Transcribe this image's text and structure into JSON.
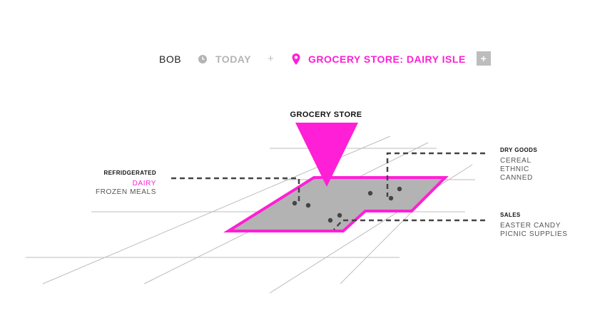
{
  "header": {
    "user": "BOB",
    "time_icon": "clock-icon",
    "time": "TODAY",
    "separator": "+",
    "location_icon": "location-pin-icon",
    "location": "GROCERY STORE: DAIRY ISLE",
    "add_label": "+"
  },
  "map": {
    "title": "GROCERY STORE",
    "marker_icon": "location-marker-triangle",
    "sections": {
      "refrigerated": {
        "heading": "REFRIDGERATED",
        "items": [
          "DAIRY",
          "FROZEN MEALS"
        ],
        "active_item": "DAIRY"
      },
      "dry_goods": {
        "heading": "DRY GOODS",
        "items": [
          "CEREAL",
          "ETHNIC",
          "CANNED"
        ]
      },
      "sales": {
        "heading": "SALES",
        "items": [
          "EASTER CANDY",
          "PICNIC SUPPLIES"
        ]
      }
    }
  },
  "colors": {
    "accent": "#ff1fd6",
    "floor": "#b3b3b3",
    "grid": "#bdbdbd",
    "leader": "#444444",
    "muted": "#b4b4b4"
  }
}
